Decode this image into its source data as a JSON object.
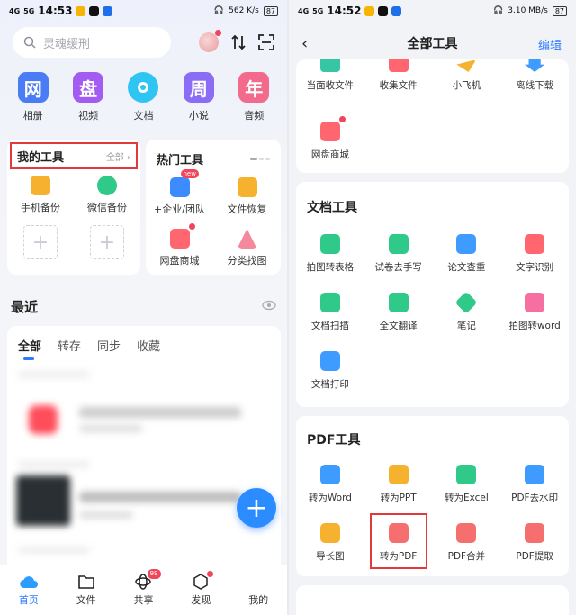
{
  "left": {
    "status": {
      "time": "14:53",
      "net": "4G",
      "net2": "5G",
      "speed": "562 K/s",
      "battery": "87"
    },
    "search_placeholder": "灵魂缓刑",
    "quick": [
      {
        "label": "相册",
        "glyph": "网",
        "color": "#4a7df5"
      },
      {
        "label": "视频",
        "glyph": "盘",
        "color": "#a25cf2"
      },
      {
        "label": "文档",
        "glyph": "",
        "color": "#2ec5f2"
      },
      {
        "label": "小说",
        "glyph": "周",
        "color": "#8a6cf5"
      },
      {
        "label": "音频",
        "glyph": "年",
        "color": "#f36b8c"
      }
    ],
    "my_tools": {
      "title": "我的工具",
      "all": "全部",
      "items": [
        {
          "label": "手机备份",
          "color": "#f6b12e"
        },
        {
          "label": "微信备份",
          "color": "#2fca8a"
        }
      ]
    },
    "hot_tools": {
      "title": "热门工具",
      "new_badge": "new",
      "items": [
        {
          "label": "+企业/团队",
          "color": "#3e8bff"
        },
        {
          "label": "文件恢复",
          "color": "#f6b12e"
        },
        {
          "label": "网盘商城",
          "color": "#ff6670"
        },
        {
          "label": "分类找图",
          "color": "#f4899c"
        }
      ]
    },
    "recent": {
      "title": "最近",
      "tabs": [
        "全部",
        "转存",
        "同步",
        "收藏"
      ]
    },
    "tabbar": [
      {
        "label": "首页",
        "icon": "cloud-icon"
      },
      {
        "label": "文件",
        "icon": "folder-icon"
      },
      {
        "label": "共享",
        "icon": "share-icon",
        "badge": "99"
      },
      {
        "label": "发现",
        "icon": "discover-icon"
      },
      {
        "label": "我的",
        "icon": "profile-icon"
      }
    ]
  },
  "right": {
    "status": {
      "time": "14:52",
      "net": "4G",
      "net2": "5G",
      "speed": "3.10 MB/s",
      "battery": "87"
    },
    "title": "全部工具",
    "edit": "编辑",
    "top_items": [
      {
        "label": "当面收文件",
        "color": "#36c6a4"
      },
      {
        "label": "收集文件",
        "color": "#ff6670"
      },
      {
        "label": "小飞机",
        "color": "#f6b12e"
      },
      {
        "label": "离线下载",
        "color": "#3e9bff"
      },
      {
        "label": "网盘商城",
        "color": "#ff6670"
      }
    ],
    "doc_tools": {
      "title": "文档工具",
      "items": [
        {
          "label": "拍图转表格",
          "color": "#2fca8a"
        },
        {
          "label": "试卷去手写",
          "color": "#2fca8a"
        },
        {
          "label": "论文查重",
          "color": "#3e9bff"
        },
        {
          "label": "文字识别",
          "color": "#ff6670"
        },
        {
          "label": "文档扫描",
          "color": "#2fca8a"
        },
        {
          "label": "全文翻译",
          "color": "#2fca8a"
        },
        {
          "label": "笔记",
          "color": "#2fca8a"
        },
        {
          "label": "拍图转word",
          "color": "#f56fa0"
        },
        {
          "label": "文档打印",
          "color": "#3e9bff"
        }
      ]
    },
    "pdf_tools": {
      "title": "PDF工具",
      "items": [
        {
          "label": "转为Word",
          "color": "#3e9bff"
        },
        {
          "label": "转为PPT",
          "color": "#f6b12e"
        },
        {
          "label": "转为Excel",
          "color": "#2fca8a"
        },
        {
          "label": "PDF去水印",
          "color": "#3e9bff"
        },
        {
          "label": "导长图",
          "color": "#f6b12e"
        },
        {
          "label": "转为PDF",
          "color": "#f56f6f"
        },
        {
          "label": "PDF合并",
          "color": "#f56f6f"
        },
        {
          "label": "PDF提取",
          "color": "#f56f6f"
        }
      ]
    }
  }
}
